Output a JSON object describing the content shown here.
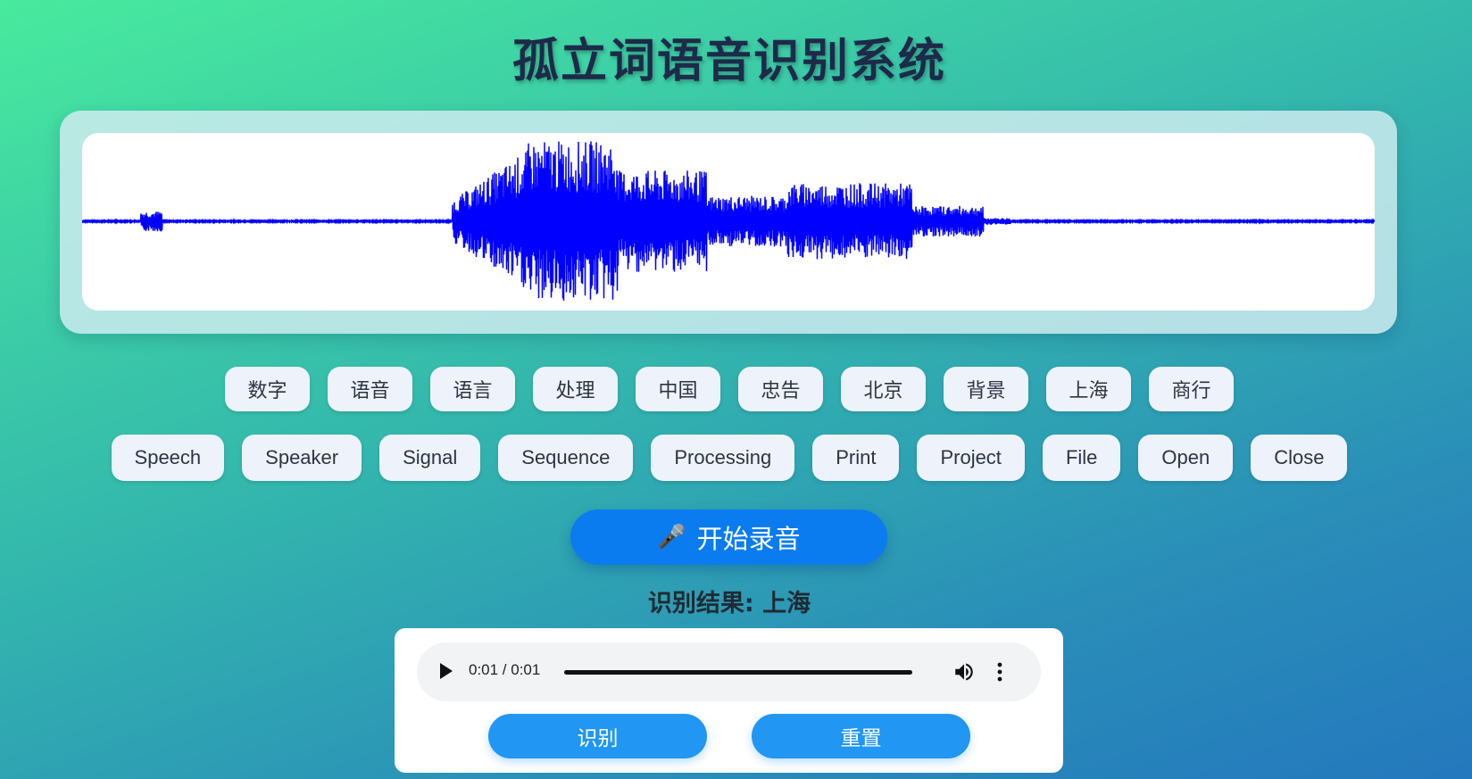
{
  "app": {
    "title": "孤立词语音识别系统"
  },
  "waveform": {
    "color": "#0000ff",
    "background": "#ffffff"
  },
  "word_buttons_cn": [
    "数字",
    "语音",
    "语言",
    "处理",
    "中国",
    "忠告",
    "北京",
    "背景",
    "上海",
    "商行"
  ],
  "word_buttons_en": [
    "Speech",
    "Speaker",
    "Signal",
    "Sequence",
    "Processing",
    "Print",
    "Project",
    "File",
    "Open",
    "Close"
  ],
  "record": {
    "icon": "microphone-icon",
    "label": "开始录音"
  },
  "result": {
    "text": "识别结果: 上海"
  },
  "player": {
    "time": "0:01 / 0:01",
    "progress": 1.0
  },
  "actions": {
    "identify_label": "识别",
    "reset_label": "重置"
  },
  "colors": {
    "primary": "#0a7cf0",
    "action": "#2196f3",
    "title": "#1d2a4a"
  }
}
